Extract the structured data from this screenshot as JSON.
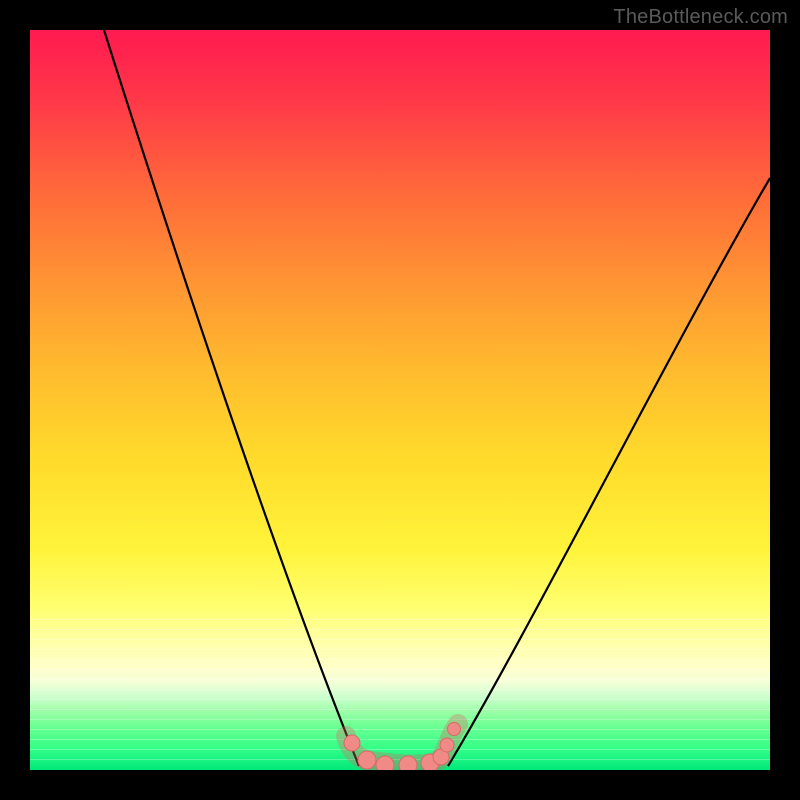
{
  "watermark": "TheBottleneck.com",
  "colors": {
    "black": "#000000",
    "curve": "#000000",
    "marker_fill": "#ef8a86",
    "marker_stroke": "#d66a66"
  },
  "chart_data": {
    "type": "line",
    "title": "",
    "xlabel": "",
    "ylabel": "",
    "xlim": [
      0,
      100
    ],
    "ylim": [
      0,
      100
    ],
    "series": [
      {
        "name": "left-curve",
        "x": [
          10,
          14,
          18,
          22,
          26,
          30,
          34,
          38,
          42,
          44.5
        ],
        "y": [
          100,
          88,
          76,
          63,
          50,
          38,
          26,
          15,
          6,
          0.5
        ]
      },
      {
        "name": "right-curve",
        "x": [
          56.5,
          60,
          64,
          70,
          76,
          82,
          88,
          94,
          100
        ],
        "y": [
          0.5,
          6,
          16,
          30,
          43,
          55,
          65,
          74,
          80
        ]
      },
      {
        "name": "markers",
        "x": [
          43.5,
          45.5,
          48,
          51,
          54,
          55.5,
          56.3,
          57.3
        ],
        "y": [
          3.6,
          1.4,
          0.7,
          0.7,
          1.0,
          1.8,
          3.4,
          5.6
        ]
      }
    ]
  }
}
